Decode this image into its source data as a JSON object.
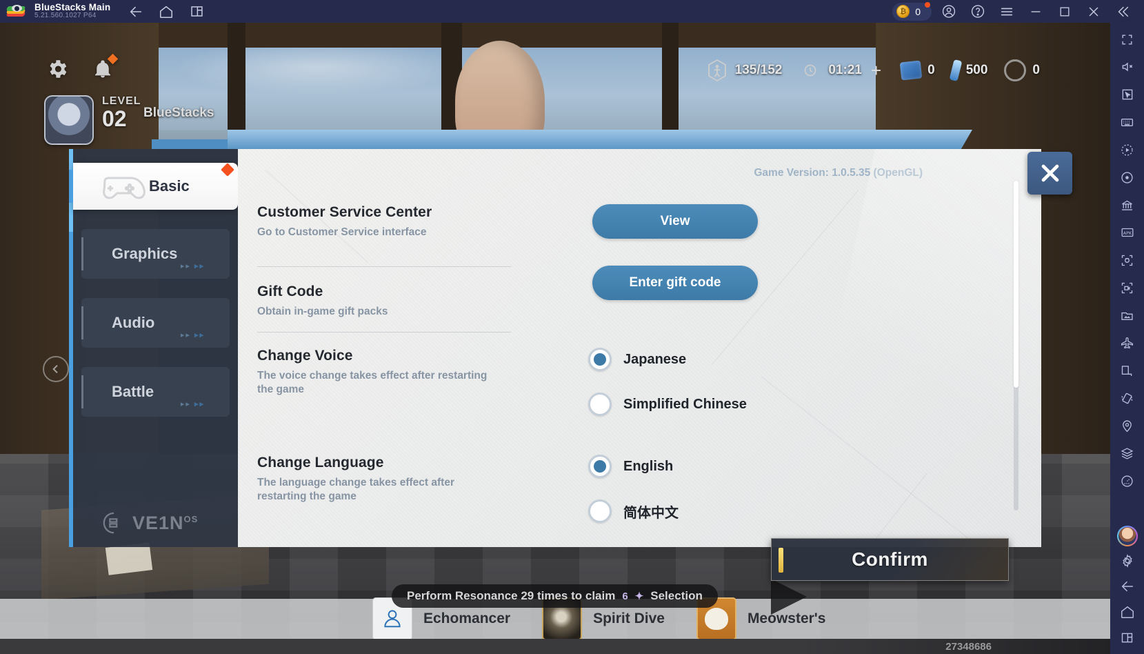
{
  "titlebar": {
    "app_name": "BlueStacks Main",
    "version": "5.21.560.1027  P64",
    "icons": [
      "bluestacks-logo",
      "back-arrow-icon",
      "home-icon",
      "multi-instance-icon"
    ],
    "coin_count": "0",
    "right_icons": [
      "account-icon",
      "help-icon",
      "menu-icon",
      "minimize-icon",
      "maximize-icon",
      "close-icon",
      "collapse-icon"
    ]
  },
  "right_sidebar": {
    "icons": [
      "fullscreen-icon",
      "mute-icon",
      "cursor-icon",
      "keyboard-icon",
      "macro-play-icon",
      "record-icon",
      "multi-instance-manager-icon",
      "install-apk-icon",
      "screenshot-icon",
      "screen-record-icon",
      "media-manager-icon",
      "airplane-icon",
      "rotate-portrait-icon",
      "shake-icon",
      "location-icon",
      "layers-icon",
      "performance-icon"
    ],
    "bottom_icons": [
      "user-avatar",
      "settings-gear-icon",
      "back-arrow-icon",
      "home-icon",
      "recents-icon"
    ]
  },
  "game_hud": {
    "gear_icon": "settings-gear-icon",
    "bell_icon": "notification-bell-icon",
    "level_label": "LEVEL",
    "level_value": "02",
    "player_name": "BlueStacks",
    "stamina": "135/152",
    "stamina_timer": "01:21",
    "currency_blue": "0",
    "currency_crystal": "500",
    "currency_ring": "0"
  },
  "settings_panel": {
    "game_version": "Game Version: 1.0.5.35 (OpenGL)",
    "close_label": "close-dialog",
    "brand": {
      "name": "VE1N",
      "sup": "OS"
    },
    "tabs": [
      {
        "id": "basic",
        "label": "Basic",
        "active": true,
        "badge": true
      },
      {
        "id": "graphics",
        "label": "Graphics",
        "active": false,
        "badge": false
      },
      {
        "id": "audio",
        "label": "Audio",
        "active": false,
        "badge": false
      },
      {
        "id": "battle",
        "label": "Battle",
        "active": false,
        "badge": false
      }
    ],
    "rows": [
      {
        "id": "customer-service",
        "label": "Customer Service Center",
        "desc": "Go to Customer Service interface",
        "control": "button",
        "button_label": "View"
      },
      {
        "id": "gift-code",
        "label": "Gift Code",
        "desc": "Obtain in-game gift packs",
        "control": "button",
        "button_label": "Enter gift code"
      },
      {
        "id": "change-voice",
        "label": "Change Voice",
        "desc": "The voice change takes effect after restarting the game",
        "control": "radio",
        "options": [
          {
            "label": "Japanese",
            "selected": true
          },
          {
            "label": "Simplified Chinese",
            "selected": false
          }
        ]
      },
      {
        "id": "change-language",
        "label": "Change Language",
        "desc": "The language change takes effect after restarting the game",
        "control": "radio",
        "options": [
          {
            "label": "English",
            "selected": true
          },
          {
            "label": "简体中文",
            "selected": false
          }
        ]
      }
    ],
    "scrollbar": {
      "position": "top",
      "thumb_fraction": 0.63
    }
  },
  "confirm_button": {
    "label": "Confirm"
  },
  "bottom": {
    "quest_text_before": "Perform Resonance 29 times to claim",
    "quest_count": "6",
    "quest_text_after": "Selection",
    "nav_items": [
      {
        "id": "echomancer",
        "label": "Echomancer",
        "icon": "person-icon"
      },
      {
        "id": "spirit-dive",
        "label": "Spirit Dive",
        "icon": "dive-thumbnail"
      },
      {
        "id": "meowsters",
        "label": "Meowster's",
        "icon": "cat-thumbnail"
      }
    ],
    "serial": "27348686"
  },
  "colors": {
    "accent_blue": "#3d7aa8",
    "panel_blue": "#4a9fe0",
    "titlebar_bg": "#262b4e",
    "badge_red": "#f4511e",
    "confirm_gold": "#e0b33d"
  }
}
